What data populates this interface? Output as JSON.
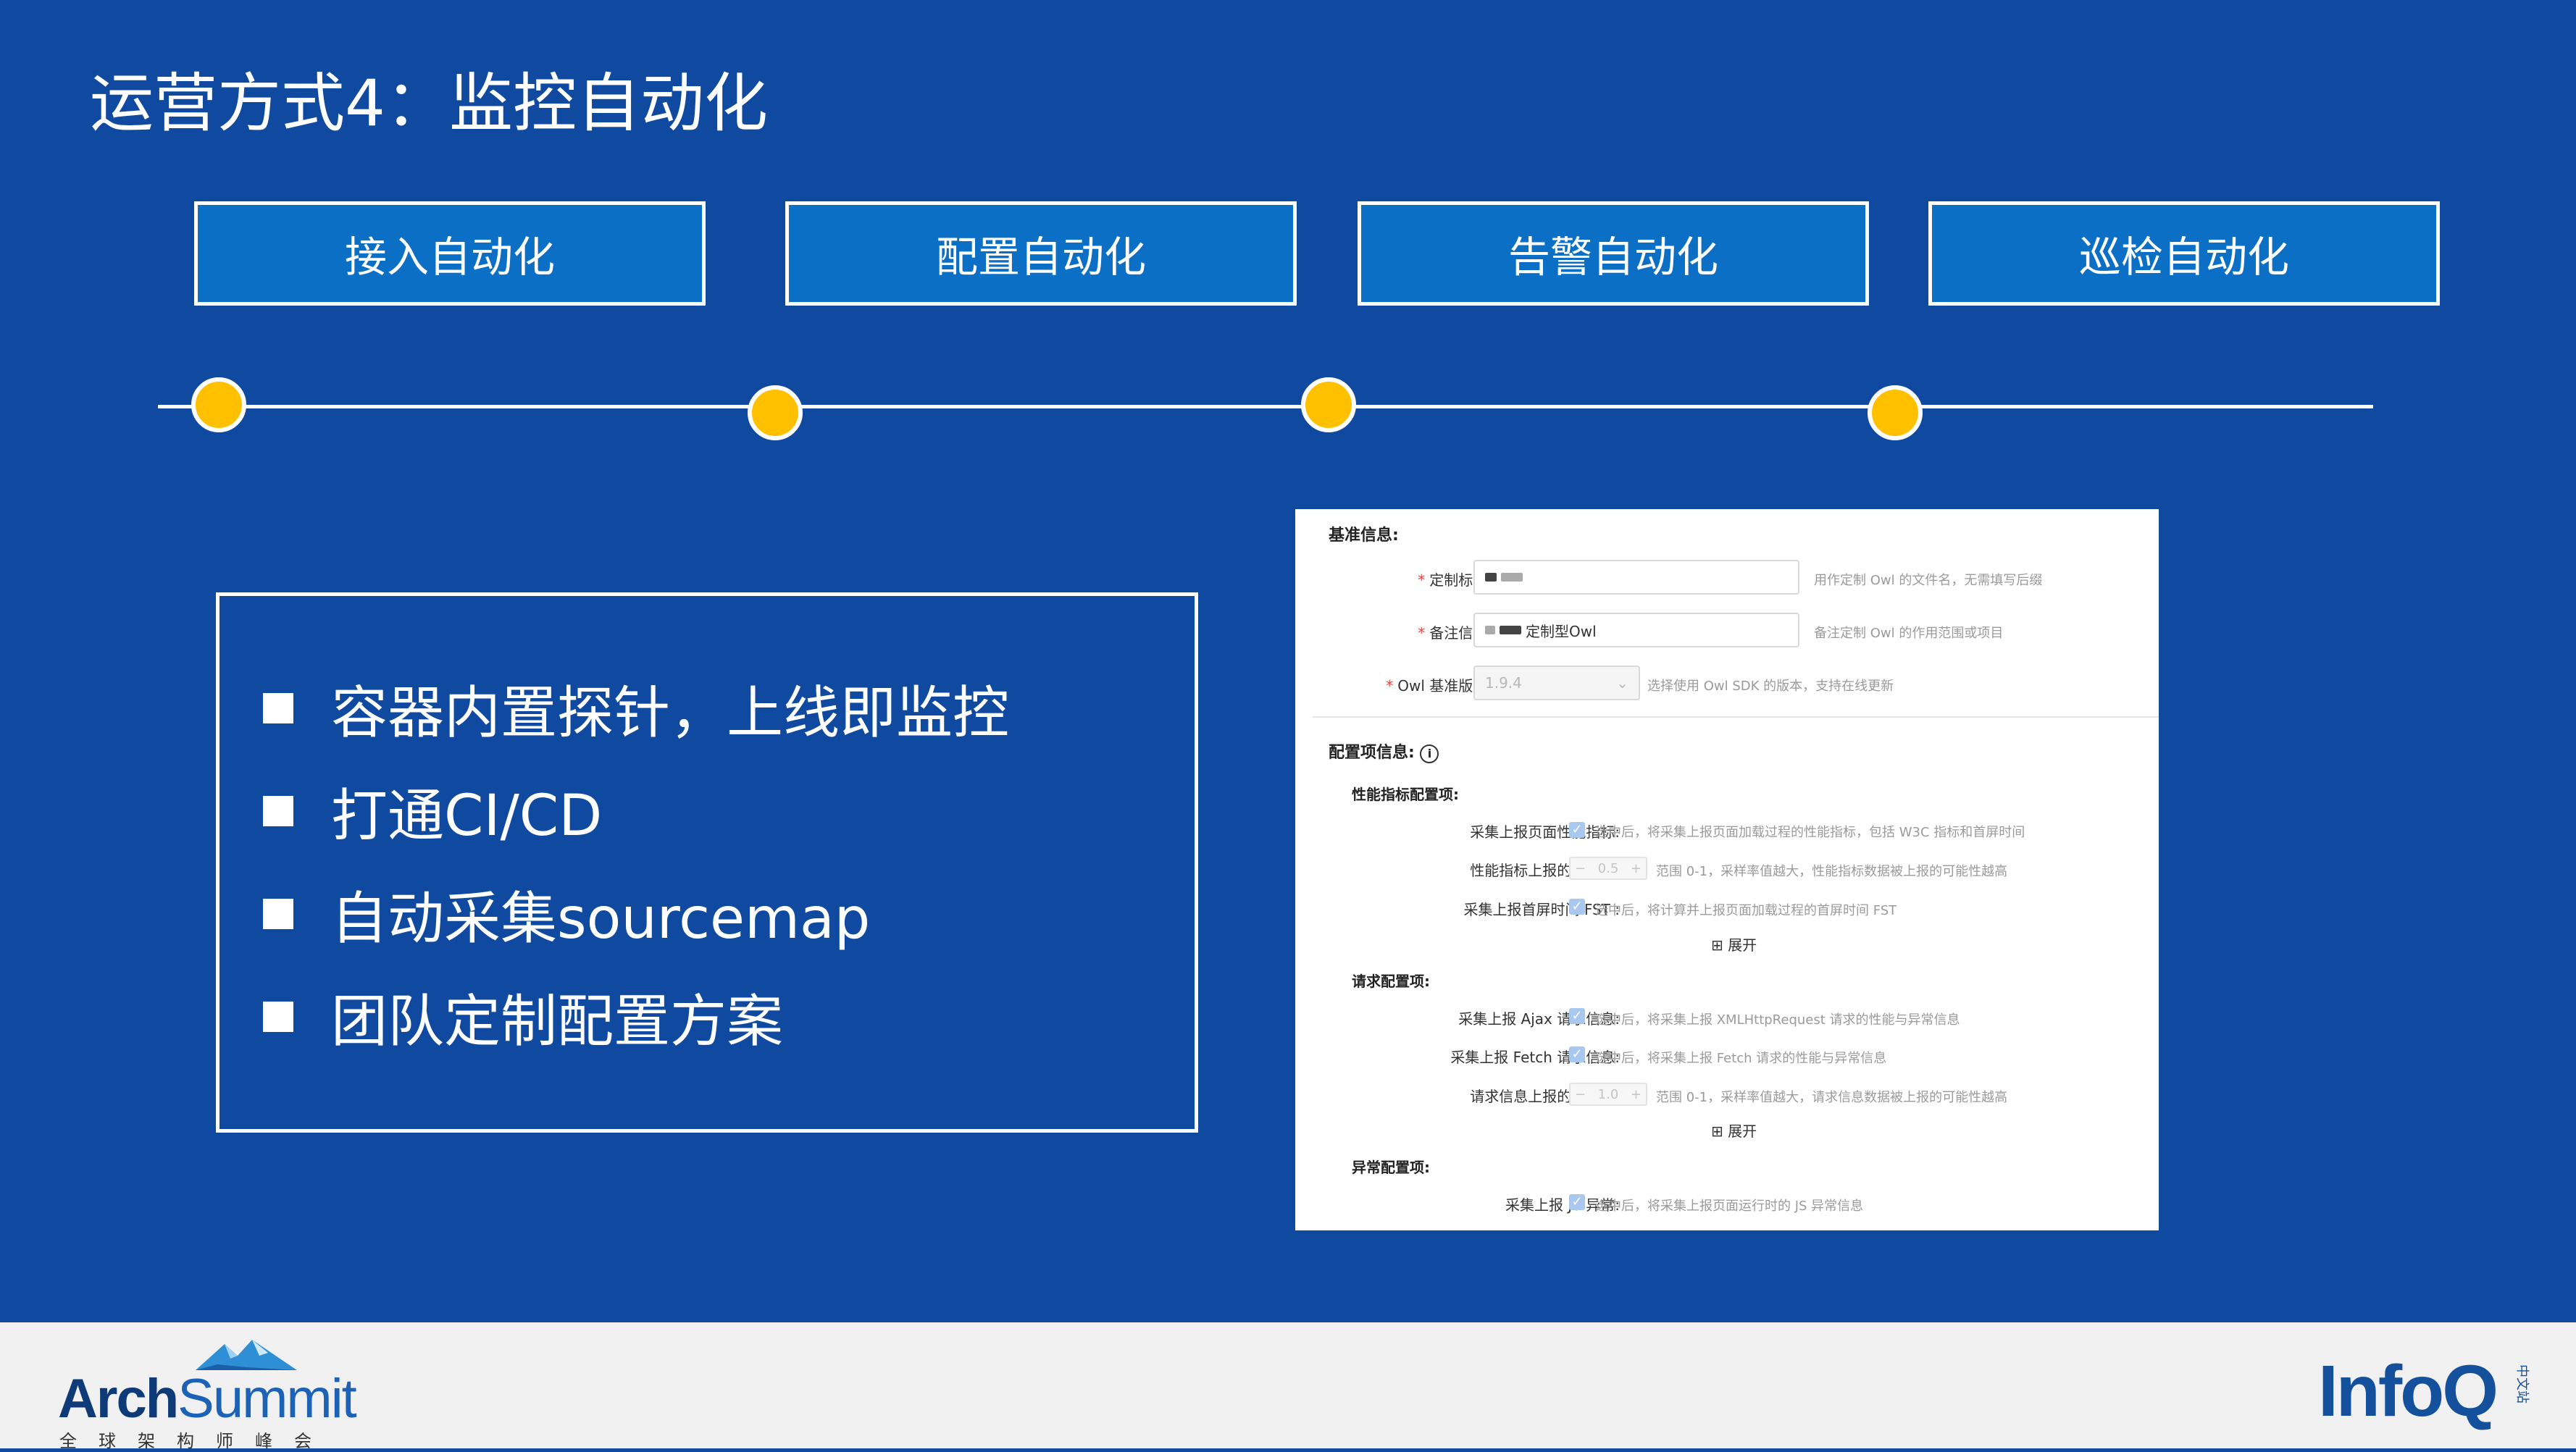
{
  "title": "运营方式4：监控自动化",
  "steps": [
    "接入自动化",
    "配置自动化",
    "告警自动化",
    "巡检自动化"
  ],
  "features": [
    "容器内置探针，上线即监控",
    "打通CI/CD",
    "自动采集sourcemap",
    "团队定制配置方案"
  ],
  "colors": {
    "background": "#0f4aa0",
    "step_fill": "#0b6fc6",
    "dot": "#ffc000",
    "footer": "#f1f1f1"
  },
  "panel": {
    "base_section": "基准信息:",
    "base_fields": [
      {
        "label": "定制标识:",
        "value": "",
        "hint": "用作定制 Owl 的文件名，无需填写后缀"
      },
      {
        "label": "备注信息:",
        "value": "定制型Owl",
        "hint": "备注定制 Owl 的作用范围或项目"
      },
      {
        "label": "Owl 基准版本:",
        "value": "1.9.4",
        "hint": "选择使用 Owl SDK 的版本，支持在线更新"
      }
    ],
    "config_section": "配置项信息:",
    "config_info_icon": "info-icon",
    "groups": [
      {
        "title": "性能指标配置项:",
        "items": [
          {
            "label": "采集上报页面性能指标:",
            "control": "checkbox",
            "hint": "选中后，将采集上报页面加载过程的性能指标，包括 W3C 指标和首屏时间"
          },
          {
            "label": "性能指标上报的采样率:",
            "control": "stepper",
            "value": "0.5",
            "hint": "范围 0-1，采样率值越大，性能指标数据被上报的可能性越高"
          },
          {
            "label": "采集上报首屏时间 FST :",
            "control": "checkbox",
            "hint": "选中后，将计算并上报页面加载过程的首屏时间 FST"
          }
        ],
        "expand": "展开"
      },
      {
        "title": "请求配置项:",
        "items": [
          {
            "label": "采集上报 Ajax 请求信息:",
            "control": "checkbox",
            "hint": "选中后，将采集上报 XMLHttpRequest 请求的性能与异常信息"
          },
          {
            "label": "采集上报 Fetch 请求信息:",
            "control": "checkbox",
            "hint": "选中后，将采集上报 Fetch 请求的性能与异常信息"
          },
          {
            "label": "请求信息上报的采样率:",
            "control": "stepper",
            "value": "1.0",
            "hint": "范围 0-1，采样率值越大，请求信息数据被上报的可能性越高"
          }
        ],
        "expand": "展开"
      },
      {
        "title": "异常配置项:",
        "items": [
          {
            "label": "采集上报 JS 异常:",
            "control": "checkbox",
            "hint": "选中后，将采集上报页面运行时的 JS 异常信息"
          }
        ]
      }
    ],
    "required_mark": "*",
    "stepper_minus": "−",
    "stepper_plus": "+",
    "expand_icon": "⊞",
    "select_arrow": "⌄"
  },
  "footer": {
    "archsummit_main": "Arch",
    "archsummit_light": "Summit",
    "archsummit_sub": "全球架构师峰会",
    "infoq": "InfoQ",
    "infoq_small": "中文站"
  }
}
